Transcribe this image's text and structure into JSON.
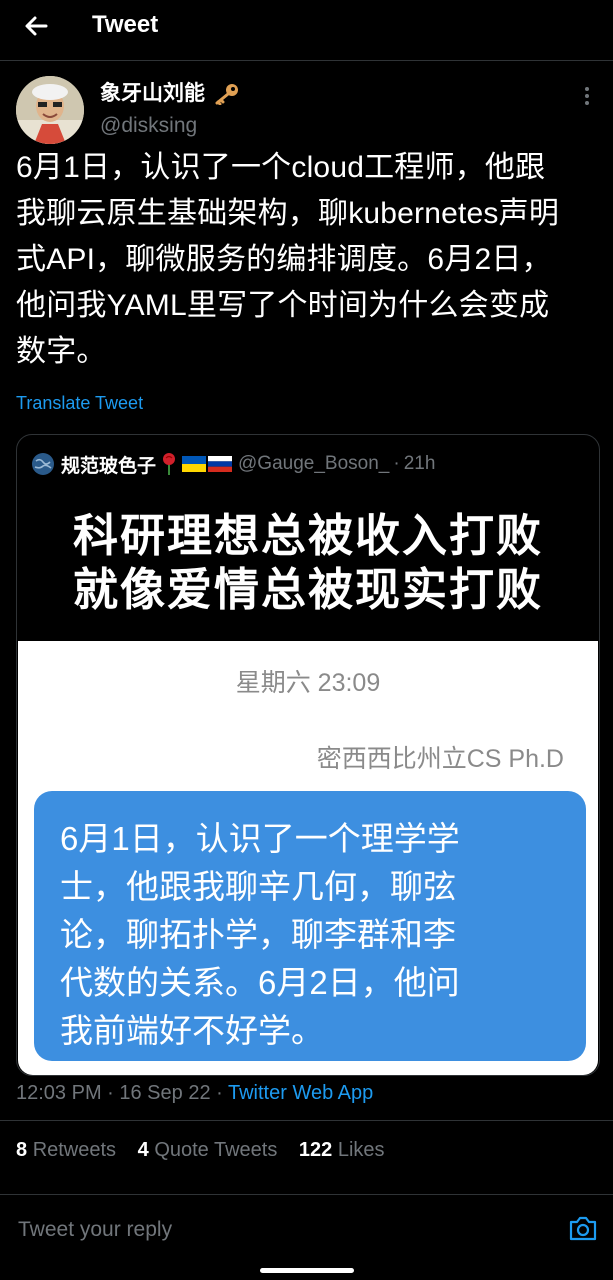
{
  "header": {
    "title": "Tweet",
    "back_icon": "arrow-left-icon"
  },
  "tweet": {
    "display_name": "象牙山刘能",
    "handle": "@disksing",
    "text": "6月1日，认识了一个cloud工程师，他跟\n我聊云原生基础架构，聊kubernetes声明\n式API，聊微服务的编排调度。6月2日，\n他问我YAML里写了个时间为什么会变成\n数字。",
    "translate_label": "Translate Tweet",
    "timestamp": "12:03 PM · 16 Sep 22 · ",
    "source_app": "Twitter Web App"
  },
  "quote": {
    "display_name": "规范玻色子",
    "handle": "@Gauge_Boson_",
    "dot": "·",
    "time": "21h",
    "meme_line1": "科研理想总被收入打败",
    "meme_line2": "就像爱情总被现实打败",
    "chat_time": "星期六 23:09",
    "chat_contact": "密西西比州立CS Ph.D",
    "bubble_lines": [
      "6月1日，认识了一个理学学",
      "士，他跟我聊辛几何，聊弦",
      "论，聊拓扑学，聊李群和李",
      "代数的关系。6月2日，他问",
      "我前端好不好学。"
    ]
  },
  "stats": {
    "retweets_count": "8",
    "retweets_label": "Retweets",
    "quotes_count": "4",
    "quotes_label": "Quote Tweets",
    "likes_count": "122",
    "likes_label": "Likes"
  },
  "reply": {
    "placeholder": "Tweet your reply"
  },
  "colors": {
    "accent": "#1d9bf0",
    "background": "#000000",
    "bubble": "#3d8fe0"
  }
}
